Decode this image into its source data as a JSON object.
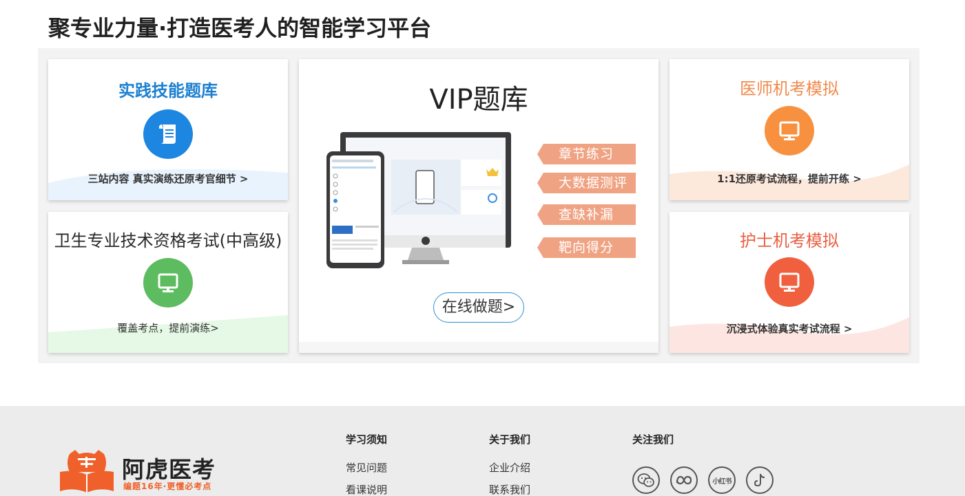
{
  "headline": "聚专业力量·打造医考人的智能学习平台",
  "cards": {
    "practice": {
      "title": "实践技能题库",
      "subtitle": "三站内容 真实演练还原考官细节 >",
      "title_color": "#1b7fd0",
      "circle_color": "#1c86e0"
    },
    "qualification": {
      "title": "卫生专业技术资格考试(中高级)",
      "subtitle": "覆盖考点，提前演练>",
      "title_color": "#2a2a2a",
      "circle_color": "#5dbc5f"
    },
    "doctor": {
      "title": "医师机考模拟",
      "subtitle": "1:1还原考试流程，提前开练 >",
      "title_color": "#f08a4c",
      "circle_color": "#f7913f"
    },
    "nurse": {
      "title": "护士机考模拟",
      "subtitle": "沉浸式体验真实考试流程 >",
      "title_color": "#e95f42",
      "circle_color": "#f05f3e"
    }
  },
  "vip": {
    "title": "VIP题库",
    "tags": [
      "章节练习",
      "大数据测评",
      "查缺补漏",
      "靶向得分"
    ],
    "button": "在线做题>",
    "tag_color": "#f0a383"
  },
  "footer": {
    "logo_name": "阿虎医考",
    "logo_slogan": "编题16年·更懂必考点",
    "brand_color": "#f0602a",
    "columns": [
      {
        "heading": "学习须知",
        "links": [
          "常见问题",
          "看课说明"
        ]
      },
      {
        "heading": "关于我们",
        "links": [
          "企业介绍",
          "联系我们"
        ]
      },
      {
        "heading": "关注我们",
        "links": []
      }
    ],
    "social_icons": [
      "wechat-icon",
      "meta-icon",
      "xiaohongshu-icon",
      "douyin-icon"
    ],
    "xiaohongshu_label": "小红书"
  }
}
